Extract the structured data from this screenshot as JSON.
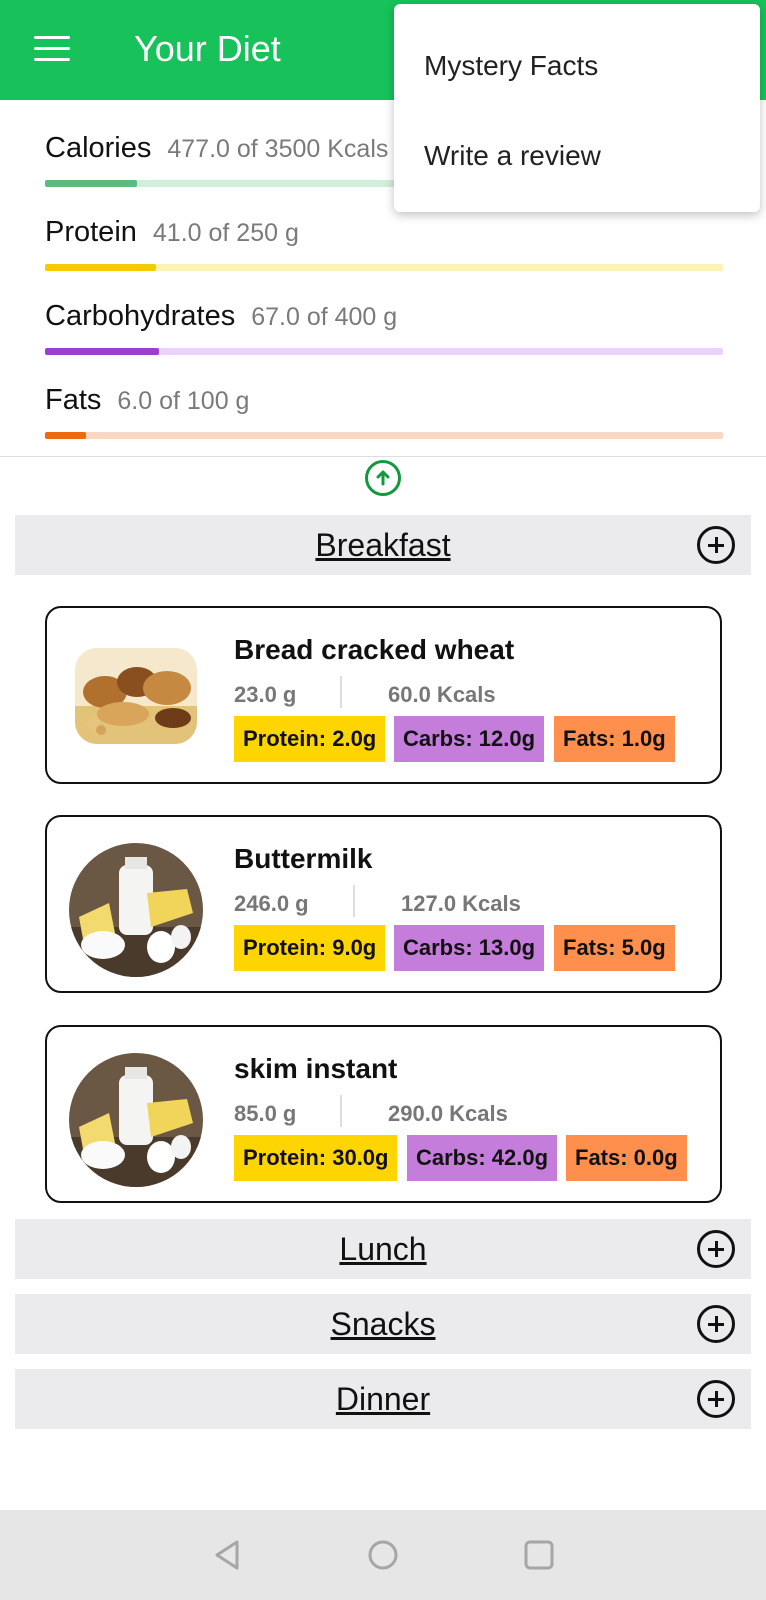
{
  "appbar": {
    "title": "Your Diet",
    "menu_icon": "hamburger-icon"
  },
  "overflow_menu": {
    "items": [
      "Mystery Facts",
      "Write a review"
    ]
  },
  "nutrients": [
    {
      "name": "Calories",
      "value": "477.0 of 3500 Kcals",
      "progress": 0.136,
      "color": "#5dbb82",
      "track": "#d3eedb"
    },
    {
      "name": "Protein",
      "value": "41.0 of 250 g",
      "progress": 0.164,
      "color": "#f2cc00",
      "track": "#fcf1b8"
    },
    {
      "name": "Carbohydrates",
      "value": "67.0 of 400 g",
      "progress": 0.1675,
      "color": "#9b3fd1",
      "track": "#ecd2f7"
    },
    {
      "name": "Fats",
      "value": "6.0 of 100 g",
      "progress": 0.06,
      "color": "#ec6a10",
      "track": "#f9d9c3"
    }
  ],
  "meals": [
    {
      "title": "Breakfast"
    },
    {
      "title": "Lunch"
    },
    {
      "title": "Snacks"
    },
    {
      "title": "Dinner"
    }
  ],
  "foods": [
    {
      "name": "Bread cracked wheat",
      "qty": "23.0 g",
      "kcal": "60.0 Kcals",
      "protein": "Protein: 2.0g",
      "carbs": "Carbs: 12.0g",
      "fats": "Fats: 1.0g"
    },
    {
      "name": "Buttermilk",
      "qty": "246.0 g",
      "kcal": "127.0 Kcals",
      "protein": "Protein: 9.0g",
      "carbs": "Carbs: 13.0g",
      "fats": "Fats: 5.0g"
    },
    {
      "name": "skim instant",
      "qty": "85.0 g",
      "kcal": "290.0 Kcals",
      "protein": "Protein: 30.0g",
      "carbs": "Carbs: 42.0g",
      "fats": "Fats: 0.0g"
    }
  ],
  "colors": {
    "accent": "#17c25a",
    "protein": "#ffd500",
    "carbs": "#c57ddb",
    "fats": "#ff8f4d"
  },
  "navbar": {
    "icons": [
      "back-icon",
      "home-icon",
      "recents-icon"
    ]
  }
}
